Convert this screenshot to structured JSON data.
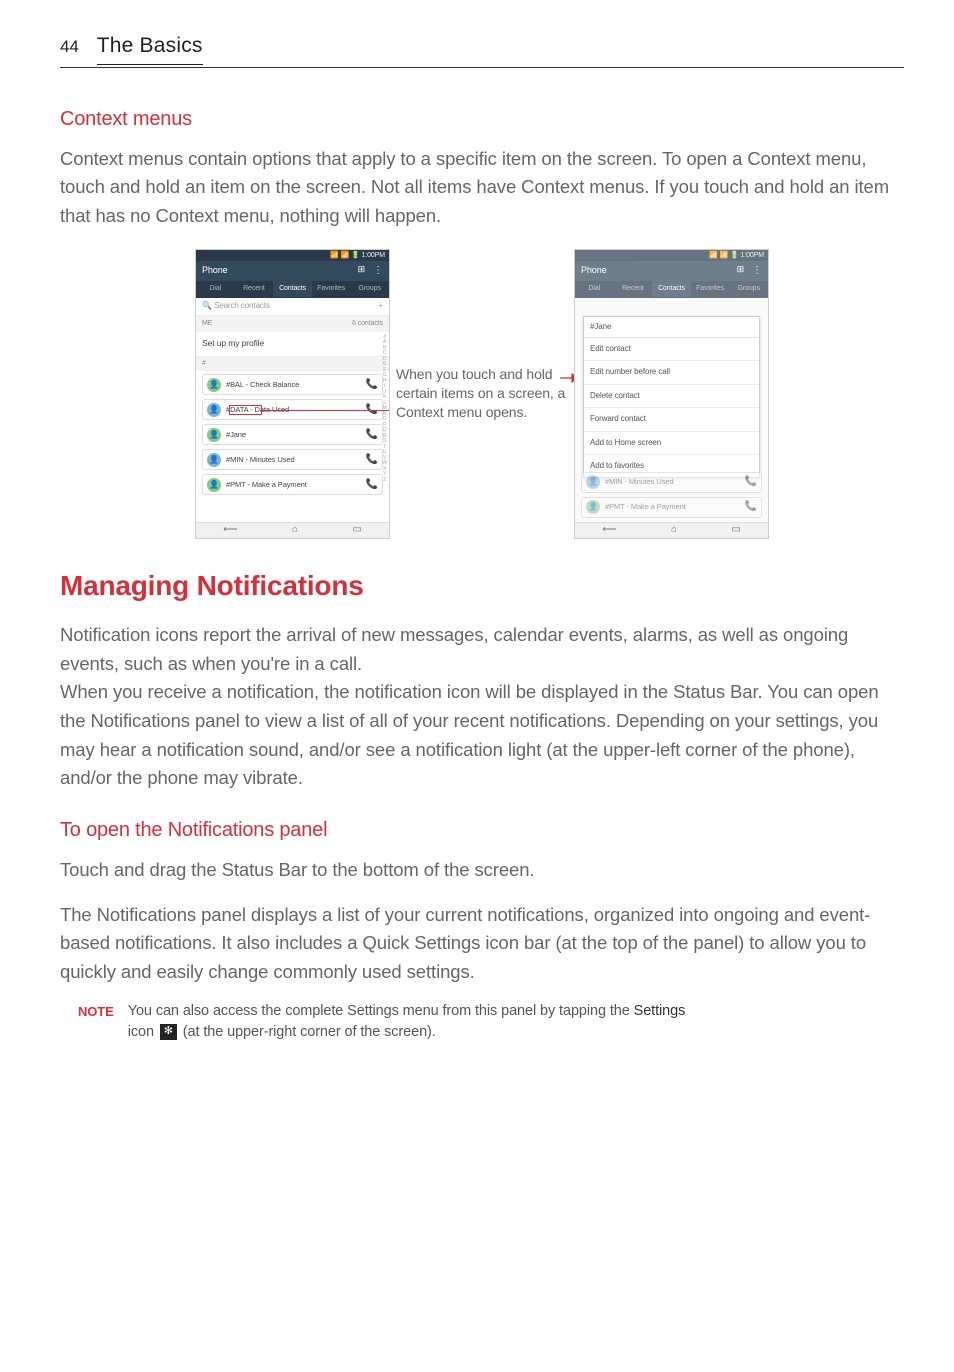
{
  "page_number": "44",
  "header_title": "The Basics",
  "context_menus": {
    "heading": "Context menus",
    "paragraph": "Context menus contain options that apply to a specific item on the screen. To open a Context menu, touch and hold an item on the screen. Not all items have Context menus. If you touch and hold an item that has no Context menu, nothing will happen."
  },
  "figure": {
    "callout_text": "When you touch and hold certain items on a screen, a Context menu opens.",
    "status_time": "1:00PM",
    "app_title": "Phone",
    "tabs": [
      "Dial",
      "Recent",
      "Contacts",
      "Favorites",
      "Groups"
    ],
    "active_tab": "Contacts",
    "search_placeholder": "Search contacts",
    "me_label": "ME",
    "contacts_count": "6 contacts",
    "profile_text": "Set up my profile",
    "hash_label": "#",
    "contacts": [
      "#BAL - Check Balance",
      "#DATA - Data Used",
      "#Jane",
      "#MIN - Minutes Used",
      "#PMT - Make a Payment"
    ],
    "index_letters": "#ABCDEFGHIJKLMNOPQRSTUVWXYZ",
    "context_menu": {
      "title": "#Jane",
      "items": [
        "Edit contact",
        "Edit number before call",
        "Delete contact",
        "Forward contact",
        "Add to Home screen",
        "Add to favorites"
      ]
    },
    "dimmed_contacts": [
      "#MIN - Minutes Used",
      "#PMT - Make a Payment"
    ]
  },
  "managing_notifications": {
    "heading": "Managing Notifications",
    "para1": "Notification icons report the arrival of new messages, calendar events, alarms, as well as ongoing events, such as when you're in a call.",
    "para2": "When you receive a notification, the notification icon will be displayed in the Status Bar. You can open the Notifications panel to view a list of all of your recent notifications. Depending on your settings, you may hear a notification sound, and/or see a notification light (at the upper-left corner of the phone), and/or the phone may vibrate."
  },
  "open_panel": {
    "heading": "To open the Notifications panel",
    "para1": "Touch and drag the Status Bar to the bottom of the screen.",
    "para2": "The Notifications panel displays a list of your current notifications, organized into ongoing and event-based notifications. It also includes a Quick Settings icon bar (at the top of the panel) to allow you to quickly and easily change commonly used settings."
  },
  "note": {
    "label": "NOTE",
    "text_prefix": "You can also access the complete Settings menu from this panel by tapping the ",
    "settings_word": "Settings",
    "text_mid": "icon ",
    "text_suffix": " (at the upper-right corner of the screen)."
  }
}
